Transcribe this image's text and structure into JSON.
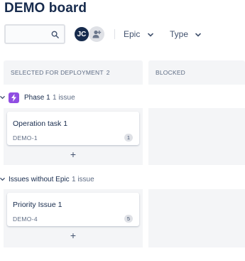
{
  "page": {
    "title": "DEMO board"
  },
  "toolbar": {
    "search": {
      "value": "",
      "placeholder": "",
      "icon": "search-icon"
    },
    "avatar_initials": "JC",
    "add_people_icon": "add-user-icon",
    "filters": [
      {
        "label": "Epic"
      },
      {
        "label": "Type"
      }
    ]
  },
  "columns": [
    {
      "label": "SELECTED FOR DEPLOYMENT",
      "count": "2"
    },
    {
      "label": "BLOCKED",
      "count": ""
    }
  ],
  "swimlanes": [
    {
      "title": "Phase 1",
      "count": "1 issue",
      "epic_color": "#904ee2",
      "card": {
        "title": "Operation task 1",
        "key": "DEMO-1",
        "badge": "1"
      },
      "add_label": "+"
    },
    {
      "title": "Issues without Epic",
      "count": "1 issue",
      "card": {
        "title": "Priority Issue 1",
        "key": "DEMO-4",
        "badge": "5"
      },
      "add_label": "+"
    }
  ],
  "colors": {
    "column_bg": "#f4f5f7",
    "avatar": "#172b4d",
    "epic": "#904ee2",
    "text": "#172b4d",
    "muted": "#5e6c84"
  }
}
